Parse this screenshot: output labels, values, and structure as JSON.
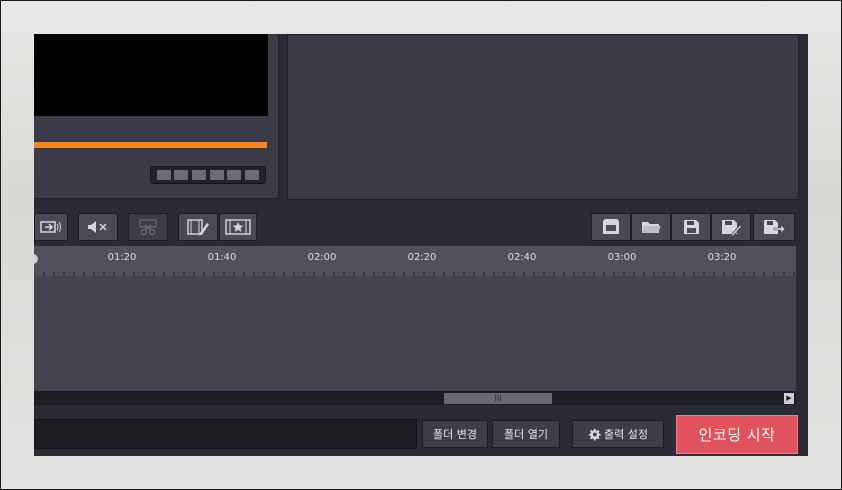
{
  "timeline": {
    "ruler_labels": [
      "01:20",
      "01:40",
      "02:00",
      "02:20",
      "02:40",
      "03:00",
      "03:20"
    ]
  },
  "playback": {
    "progress_fraction": 1.0
  },
  "scrollbar": {
    "thumb_grip": "III",
    "right_arrow": "▶"
  },
  "buttons": {
    "change_folder": "폴더 변경",
    "open_folder": "폴더 열기",
    "output_settings": "출력 설정",
    "start_encoding": "인코딩 시작"
  },
  "colors": {
    "accent_progress": "#f08a1e",
    "encode_button": "#e0525e"
  }
}
